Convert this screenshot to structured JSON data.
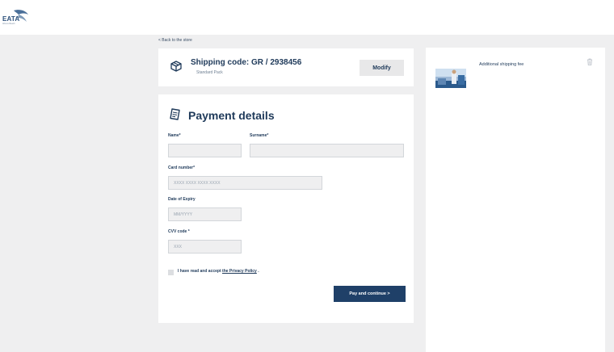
{
  "brand": {
    "logo_text": "EATA",
    "logo_sub": "Athens Beach"
  },
  "nav": {
    "back_label": "< Back to the store"
  },
  "shipping": {
    "title": "Shipping code: GR / 2938456",
    "subtitle": "Standard Pack",
    "modify_label": "Modify"
  },
  "payment": {
    "title": "Payment details",
    "name_label": "Name*",
    "name_value": "",
    "surname_label": "Surname*",
    "surname_value": "",
    "card_label": "Card number*",
    "card_placeholder": "XXXX XXXX XXXX XXXX",
    "expiry_label": "Date of Expiry",
    "expiry_placeholder": "MM/YYYY",
    "cvv_label": "CVV code *",
    "cvv_placeholder": "XXX",
    "accept_prefix": "I have read and accept",
    "policy_link": "the Privacy Policy",
    "accept_suffix": ".",
    "accept_checked": false,
    "pay_label": "Pay and continue >"
  },
  "sidebar": {
    "fee_label": "Additional shipping fee"
  },
  "colors": {
    "primary": "#1f4068",
    "text": "#1f3a5a",
    "page_bg": "#efeff0",
    "input_bg": "#efeff0"
  }
}
